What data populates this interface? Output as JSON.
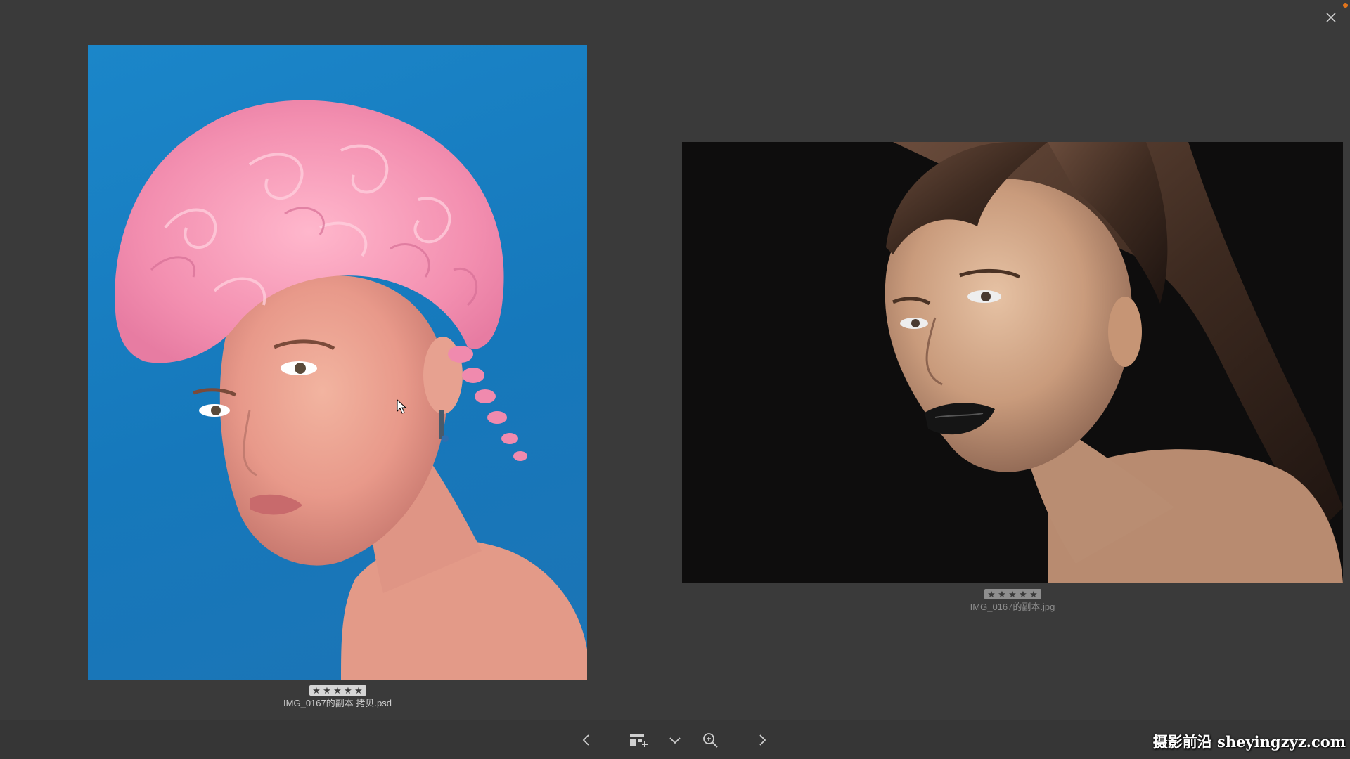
{
  "viewer": {
    "close_label": "close",
    "notification_color": "#e0741c"
  },
  "photos": [
    {
      "filename": "IMG_0167的副本 拷贝.psd",
      "rating": 5,
      "rating_max": 5,
      "background_color": "#1678bb",
      "subject": "pink-curly-hair-portrait"
    },
    {
      "filename": "IMG_0167的副本.jpg",
      "rating": 5,
      "rating_max": 5,
      "background_color": "#0e0d0d",
      "subject": "dark-lipstick-portrait"
    }
  ],
  "toolbar": {
    "items": [
      {
        "name": "previous-button",
        "icon": "chevron-left-icon"
      },
      {
        "name": "layout-button",
        "icon": "layout-add-icon"
      },
      {
        "name": "layout-dropdown-button",
        "icon": "chevron-down-icon"
      },
      {
        "name": "zoom-button",
        "icon": "zoom-in-icon"
      },
      {
        "name": "next-button",
        "icon": "chevron-right-icon"
      }
    ]
  },
  "watermark": {
    "text": "摄影前沿 sheyingzyz.com"
  }
}
